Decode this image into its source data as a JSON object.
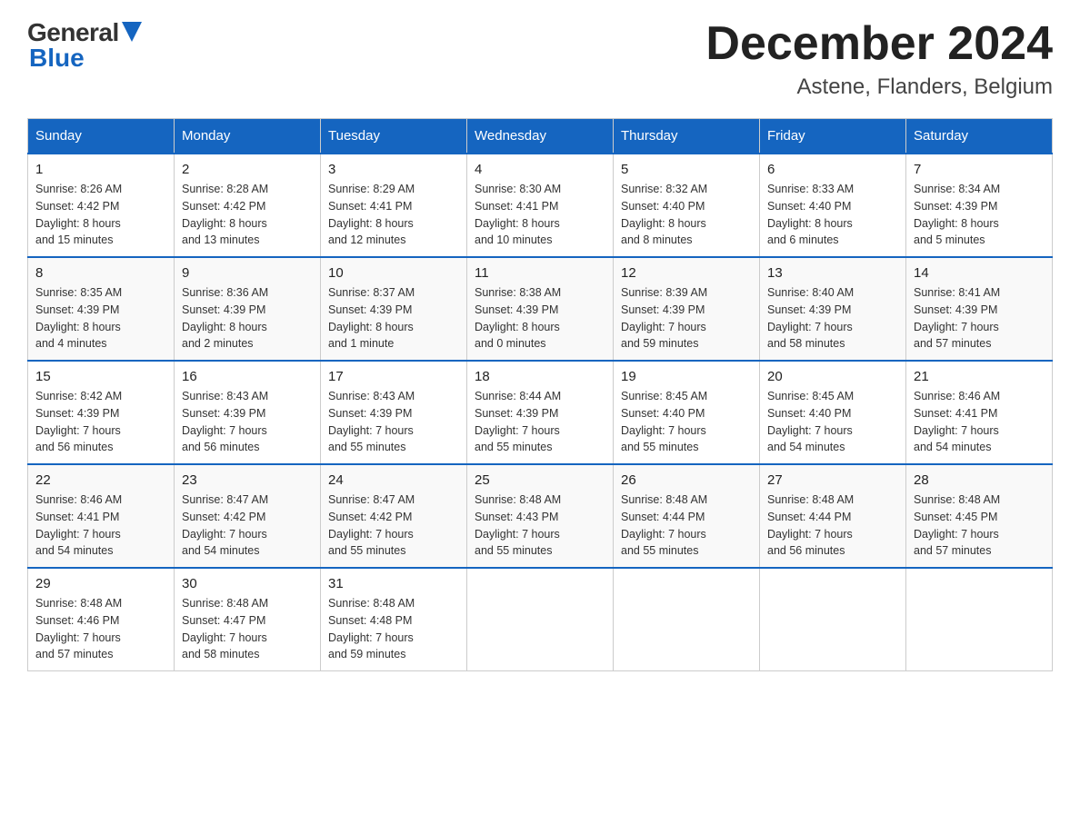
{
  "header": {
    "logo_general": "General",
    "logo_blue": "Blue",
    "month_title": "December 2024",
    "location": "Astene, Flanders, Belgium"
  },
  "weekdays": [
    "Sunday",
    "Monday",
    "Tuesday",
    "Wednesday",
    "Thursday",
    "Friday",
    "Saturday"
  ],
  "weeks": [
    [
      {
        "day": "1",
        "sunrise": "8:26 AM",
        "sunset": "4:42 PM",
        "daylight": "8 hours and 15 minutes."
      },
      {
        "day": "2",
        "sunrise": "8:28 AM",
        "sunset": "4:42 PM",
        "daylight": "8 hours and 13 minutes."
      },
      {
        "day": "3",
        "sunrise": "8:29 AM",
        "sunset": "4:41 PM",
        "daylight": "8 hours and 12 minutes."
      },
      {
        "day": "4",
        "sunrise": "8:30 AM",
        "sunset": "4:41 PM",
        "daylight": "8 hours and 10 minutes."
      },
      {
        "day": "5",
        "sunrise": "8:32 AM",
        "sunset": "4:40 PM",
        "daylight": "8 hours and 8 minutes."
      },
      {
        "day": "6",
        "sunrise": "8:33 AM",
        "sunset": "4:40 PM",
        "daylight": "8 hours and 6 minutes."
      },
      {
        "day": "7",
        "sunrise": "8:34 AM",
        "sunset": "4:39 PM",
        "daylight": "8 hours and 5 minutes."
      }
    ],
    [
      {
        "day": "8",
        "sunrise": "8:35 AM",
        "sunset": "4:39 PM",
        "daylight": "8 hours and 4 minutes."
      },
      {
        "day": "9",
        "sunrise": "8:36 AM",
        "sunset": "4:39 PM",
        "daylight": "8 hours and 2 minutes."
      },
      {
        "day": "10",
        "sunrise": "8:37 AM",
        "sunset": "4:39 PM",
        "daylight": "8 hours and 1 minute."
      },
      {
        "day": "11",
        "sunrise": "8:38 AM",
        "sunset": "4:39 PM",
        "daylight": "8 hours and 0 minutes."
      },
      {
        "day": "12",
        "sunrise": "8:39 AM",
        "sunset": "4:39 PM",
        "daylight": "7 hours and 59 minutes."
      },
      {
        "day": "13",
        "sunrise": "8:40 AM",
        "sunset": "4:39 PM",
        "daylight": "7 hours and 58 minutes."
      },
      {
        "day": "14",
        "sunrise": "8:41 AM",
        "sunset": "4:39 PM",
        "daylight": "7 hours and 57 minutes."
      }
    ],
    [
      {
        "day": "15",
        "sunrise": "8:42 AM",
        "sunset": "4:39 PM",
        "daylight": "7 hours and 56 minutes."
      },
      {
        "day": "16",
        "sunrise": "8:43 AM",
        "sunset": "4:39 PM",
        "daylight": "7 hours and 56 minutes."
      },
      {
        "day": "17",
        "sunrise": "8:43 AM",
        "sunset": "4:39 PM",
        "daylight": "7 hours and 55 minutes."
      },
      {
        "day": "18",
        "sunrise": "8:44 AM",
        "sunset": "4:39 PM",
        "daylight": "7 hours and 55 minutes."
      },
      {
        "day": "19",
        "sunrise": "8:45 AM",
        "sunset": "4:40 PM",
        "daylight": "7 hours and 55 minutes."
      },
      {
        "day": "20",
        "sunrise": "8:45 AM",
        "sunset": "4:40 PM",
        "daylight": "7 hours and 54 minutes."
      },
      {
        "day": "21",
        "sunrise": "8:46 AM",
        "sunset": "4:41 PM",
        "daylight": "7 hours and 54 minutes."
      }
    ],
    [
      {
        "day": "22",
        "sunrise": "8:46 AM",
        "sunset": "4:41 PM",
        "daylight": "7 hours and 54 minutes."
      },
      {
        "day": "23",
        "sunrise": "8:47 AM",
        "sunset": "4:42 PM",
        "daylight": "7 hours and 54 minutes."
      },
      {
        "day": "24",
        "sunrise": "8:47 AM",
        "sunset": "4:42 PM",
        "daylight": "7 hours and 55 minutes."
      },
      {
        "day": "25",
        "sunrise": "8:48 AM",
        "sunset": "4:43 PM",
        "daylight": "7 hours and 55 minutes."
      },
      {
        "day": "26",
        "sunrise": "8:48 AM",
        "sunset": "4:44 PM",
        "daylight": "7 hours and 55 minutes."
      },
      {
        "day": "27",
        "sunrise": "8:48 AM",
        "sunset": "4:44 PM",
        "daylight": "7 hours and 56 minutes."
      },
      {
        "day": "28",
        "sunrise": "8:48 AM",
        "sunset": "4:45 PM",
        "daylight": "7 hours and 57 minutes."
      }
    ],
    [
      {
        "day": "29",
        "sunrise": "8:48 AM",
        "sunset": "4:46 PM",
        "daylight": "7 hours and 57 minutes."
      },
      {
        "day": "30",
        "sunrise": "8:48 AM",
        "sunset": "4:47 PM",
        "daylight": "7 hours and 58 minutes."
      },
      {
        "day": "31",
        "sunrise": "8:48 AM",
        "sunset": "4:48 PM",
        "daylight": "7 hours and 59 minutes."
      },
      null,
      null,
      null,
      null
    ]
  ],
  "labels": {
    "sunrise": "Sunrise:",
    "sunset": "Sunset:",
    "daylight": "Daylight:"
  }
}
